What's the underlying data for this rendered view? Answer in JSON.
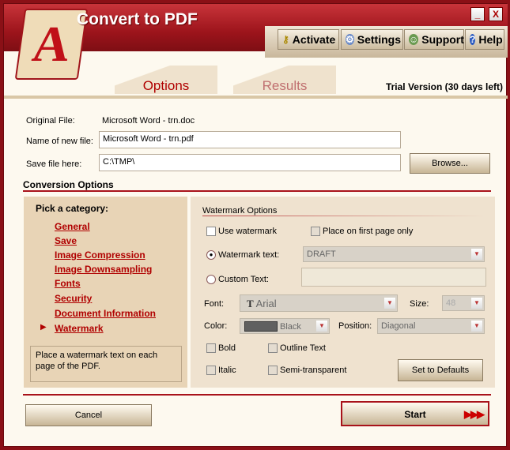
{
  "app": {
    "title": "Convert to PDF",
    "logo_letter": "A"
  },
  "window": {
    "minimize": "_",
    "close": "X"
  },
  "toolbar": {
    "activate": "Activate",
    "settings": "Settings",
    "support": "Support",
    "help": "Help"
  },
  "tabs": [
    {
      "label": "Options",
      "active": true
    },
    {
      "label": "Results",
      "active": false
    }
  ],
  "trial": "Trial Version (30 days left)",
  "file": {
    "original_label": "Original File:",
    "original_value": "Microsoft Word - trn.doc",
    "new_name_label": "Name of new  file:",
    "new_name_value": "Microsoft Word - trn.pdf",
    "save_label": "Save file here:",
    "save_value": "C:\\TMP\\",
    "browse": "Browse..."
  },
  "conversion": {
    "title": "Conversion Options",
    "pick": "Pick a category:",
    "categories": [
      "General",
      "Save",
      "Image Compression",
      "Image Downsampling",
      "Fonts",
      "Security",
      "Document Information",
      "Watermark"
    ],
    "selected": "Watermark",
    "hint": "Place a watermark text on each page of the PDF."
  },
  "watermark": {
    "title": "Watermark Options",
    "use": "Use watermark",
    "first_page": "Place on first page only",
    "text_label": "Watermark text:",
    "text_value": "DRAFT",
    "custom_label": "Custom Text:",
    "custom_value": "",
    "font_label": "Font:",
    "font_value": "Arial",
    "size_label": "Size:",
    "size_value": "48",
    "color_label": "Color:",
    "color_value": "Black",
    "color_swatch": "#606060",
    "position_label": "Position:",
    "position_value": "Diagonal",
    "bold": "Bold",
    "outline": "Outline Text",
    "italic": "Italic",
    "semi": "Semi-transparent",
    "defaults": "Set to Defaults"
  },
  "footer": {
    "cancel": "Cancel",
    "start": "Start",
    "start_arrows": "▶▶▶"
  },
  "colors": {
    "frame": "#a8121a",
    "accent_text": "#b00000"
  }
}
